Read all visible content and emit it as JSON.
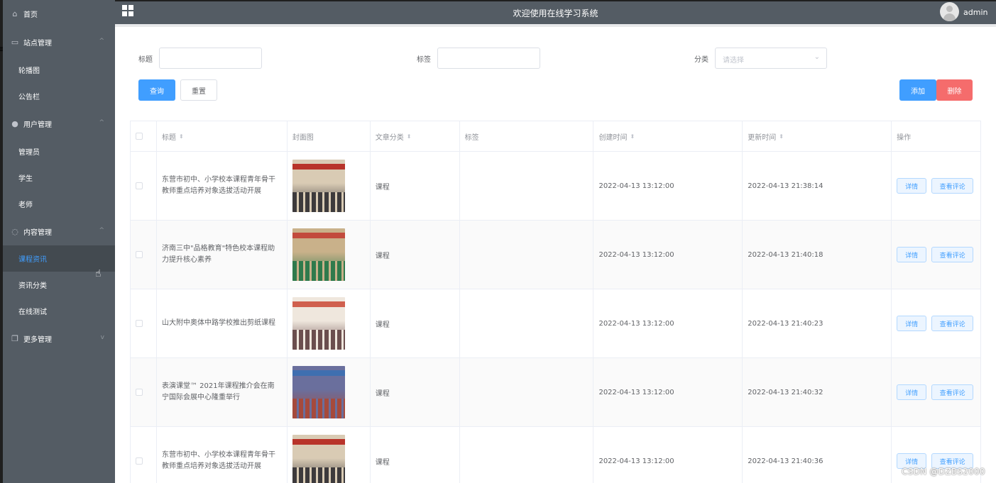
{
  "header": {
    "title": "欢迎使用在线学习系统",
    "username": "admin"
  },
  "sidebar": {
    "home": "首页",
    "groups": [
      {
        "label": "站点管理",
        "icon": "monitor-icon",
        "items": [
          "轮播图",
          "公告栏"
        ]
      },
      {
        "label": "用户管理",
        "icon": "user-icon",
        "items": [
          "管理员",
          "学生",
          "老师"
        ]
      },
      {
        "label": "内容管理",
        "icon": "chat-icon",
        "items": [
          "课程资讯",
          "资讯分类",
          "在线测试"
        ]
      },
      {
        "label": "更多管理",
        "icon": "copy-icon",
        "items": []
      }
    ],
    "active_item": "课程资讯"
  },
  "filters": {
    "title_label": "标题",
    "title_value": "",
    "tag_label": "标签",
    "tag_value": "",
    "category_label": "分类",
    "category_placeholder": "请选择"
  },
  "buttons": {
    "query": "查询",
    "reset": "重置",
    "add": "添加",
    "delete": "删除"
  },
  "table": {
    "columns": [
      "标题",
      "封面图",
      "文章分类",
      "标签",
      "创建时间",
      "更新时间",
      "操作"
    ],
    "rows": [
      {
        "title": "东营市初中、小学校本课程青年骨干教师重点培养对象选拔活动开展",
        "category": "课程",
        "tag": "",
        "created": "2022-04-13 13:12:00",
        "updated": "2022-04-13 21:38:14",
        "thumb": "lecture-hall-banner"
      },
      {
        "title": "济南三中\"品格教育\"特色校本课程助力提升核心素养",
        "category": "课程",
        "tag": "",
        "created": "2022-04-13 13:12:00",
        "updated": "2022-04-13 21:40:18",
        "thumb": "students-green-uniform"
      },
      {
        "title": "山大附中奥体中路学校推出剪纸课程",
        "category": "课程",
        "tag": "",
        "created": "2022-04-13 13:12:00",
        "updated": "2022-04-13 21:40:23",
        "thumb": "paper-cutting-class"
      },
      {
        "title": "表演课堂™ 2021年课程推介会在南宁国际会展中心隆重举行",
        "category": "课程",
        "tag": "",
        "created": "2022-04-13 13:12:00",
        "updated": "2022-04-13 21:40:32",
        "thumb": "conference-stage"
      },
      {
        "title": "东营市初中、小学校本课程青年骨干教师重点培养对象选拔活动开展",
        "category": "课程",
        "tag": "",
        "created": "2022-04-13 13:12:00",
        "updated": "2022-04-13 21:40:36",
        "thumb": "lecture-hall-banner"
      }
    ],
    "action_detail": "详情",
    "action_comments": "查看评论"
  },
  "watermark": "CSDN @DZBS2000"
}
